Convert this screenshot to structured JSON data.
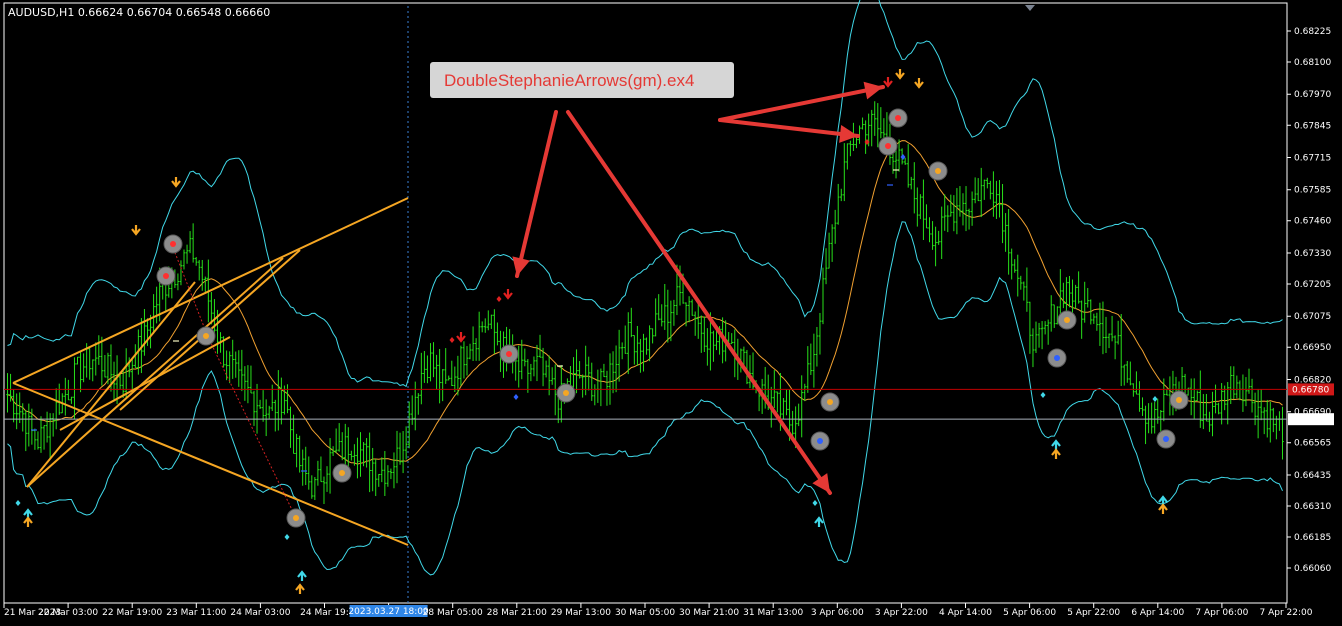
{
  "chart_data": {
    "type": "candlestick",
    "symbol_info": "AUDUSD,H1  0.66624 0.66704 0.66548 0.66660",
    "annotation": "DoubleStephanieArrows(gm).ex4",
    "ylim": [
      0.6608,
      0.683
    ],
    "y_ticks": [
      "0.68225",
      "0.68100",
      "0.67970",
      "0.67845",
      "0.67715",
      "0.67585",
      "0.67460",
      "0.67330",
      "0.67205",
      "0.67075",
      "0.66950",
      "0.66820",
      "0.66690",
      "0.66565",
      "0.66435",
      "0.66310",
      "0.66185",
      "0.66060"
    ],
    "x_tick_labels": [
      "21 Mar 2023",
      "22 Mar 03:00",
      "22 Mar 19:00",
      "23 Mar 11:00",
      "24 Mar 03:00",
      "24 Mar 19:",
      "2023.03.27 18:00",
      "28 Mar 05:00",
      "28 Mar 21:00",
      "29 Mar 13:00",
      "30 Mar 05:00",
      "30 Mar 21:00",
      "31 Mar 13:00",
      "3 Apr 06:00",
      "3 Apr 22:00",
      "4 Apr 14:00",
      "5 Apr 06:00",
      "5 Apr 22:00",
      "6 Apr 14:00",
      "7 Apr 06:00",
      "7 Apr 22:00"
    ],
    "price_lines": [
      {
        "label": "0.66780",
        "value": 0.6678,
        "color": "#c00000"
      },
      {
        "label": "0.66660",
        "value": 0.6666,
        "color": "#aab2bd"
      }
    ],
    "close_series": [
      0.6676,
      0.6672,
      0.6668,
      0.6661,
      0.6657,
      0.6663,
      0.6669,
      0.6674,
      0.6678,
      0.6685,
      0.6688,
      0.6691,
      0.6689,
      0.6686,
      0.6683,
      0.6681,
      0.6688,
      0.6694,
      0.67,
      0.671,
      0.6718,
      0.6722,
      0.6726,
      0.6731,
      0.6734,
      0.6727,
      0.6716,
      0.6704,
      0.6693,
      0.6688,
      0.6681,
      0.6678,
      0.6675,
      0.6672,
      0.6668,
      0.6672,
      0.6676,
      0.666,
      0.6648,
      0.6642,
      0.6638,
      0.6645,
      0.665,
      0.6652,
      0.6655,
      0.6657,
      0.6653,
      0.665,
      0.6647,
      0.6645,
      0.6648,
      0.6652,
      0.6663,
      0.6675,
      0.6686,
      0.669,
      0.6684,
      0.6679,
      0.6683,
      0.669,
      0.6697,
      0.67,
      0.6705,
      0.6703,
      0.6697,
      0.6692,
      0.6688,
      0.6684,
      0.6686,
      0.6688,
      0.6682,
      0.6678,
      0.6674,
      0.668,
      0.6682,
      0.6684,
      0.6681,
      0.6678,
      0.6683,
      0.669,
      0.6697,
      0.67,
      0.6698,
      0.6696,
      0.6702,
      0.6706,
      0.6709,
      0.6714,
      0.6718,
      0.6712,
      0.6704,
      0.67,
      0.6696,
      0.6698,
      0.67,
      0.6694,
      0.6688,
      0.6682,
      0.6678,
      0.6674,
      0.6672,
      0.6668,
      0.6664,
      0.667,
      0.668,
      0.6694,
      0.6714,
      0.6734,
      0.6752,
      0.6768,
      0.6778,
      0.6783,
      0.6786,
      0.6784,
      0.678,
      0.6776,
      0.677,
      0.6763,
      0.6756,
      0.675,
      0.6744,
      0.6738,
      0.6744,
      0.675,
      0.6754,
      0.6752,
      0.6756,
      0.676,
      0.6762,
      0.6755,
      0.6742,
      0.673,
      0.6718,
      0.6705,
      0.6695,
      0.67,
      0.6708,
      0.6716,
      0.672,
      0.6714,
      0.671,
      0.6712,
      0.6708,
      0.6702,
      0.6698,
      0.6692,
      0.6686,
      0.6678,
      0.667,
      0.6665,
      0.6668,
      0.6674,
      0.6678,
      0.668,
      0.6676,
      0.6672,
      0.6666,
      0.6668,
      0.6674,
      0.668,
      0.6682,
      0.6679,
      0.6675,
      0.667,
      0.6668,
      0.6664,
      0.6662
    ],
    "sell_signals": [
      {
        "time": "22 Mar 19:00",
        "price": 0.674
      },
      {
        "time": "22 Mar 19:00",
        "price": 0.6728
      },
      {
        "time": "28 Mar 05:00",
        "price": 0.67
      },
      {
        "time": "3 Apr 06:00",
        "price": 0.678
      },
      {
        "time": "3 Apr 22:00",
        "price": 0.6788
      }
    ],
    "buy_signals": [
      {
        "time": "24 Mar 03:00",
        "price": 0.664
      },
      {
        "time": "31 Mar 13:00",
        "price": 0.6668
      },
      {
        "time": "5 Apr 06:00",
        "price": 0.6697
      },
      {
        "time": "6 Apr 14:00",
        "price": 0.6666
      }
    ]
  }
}
